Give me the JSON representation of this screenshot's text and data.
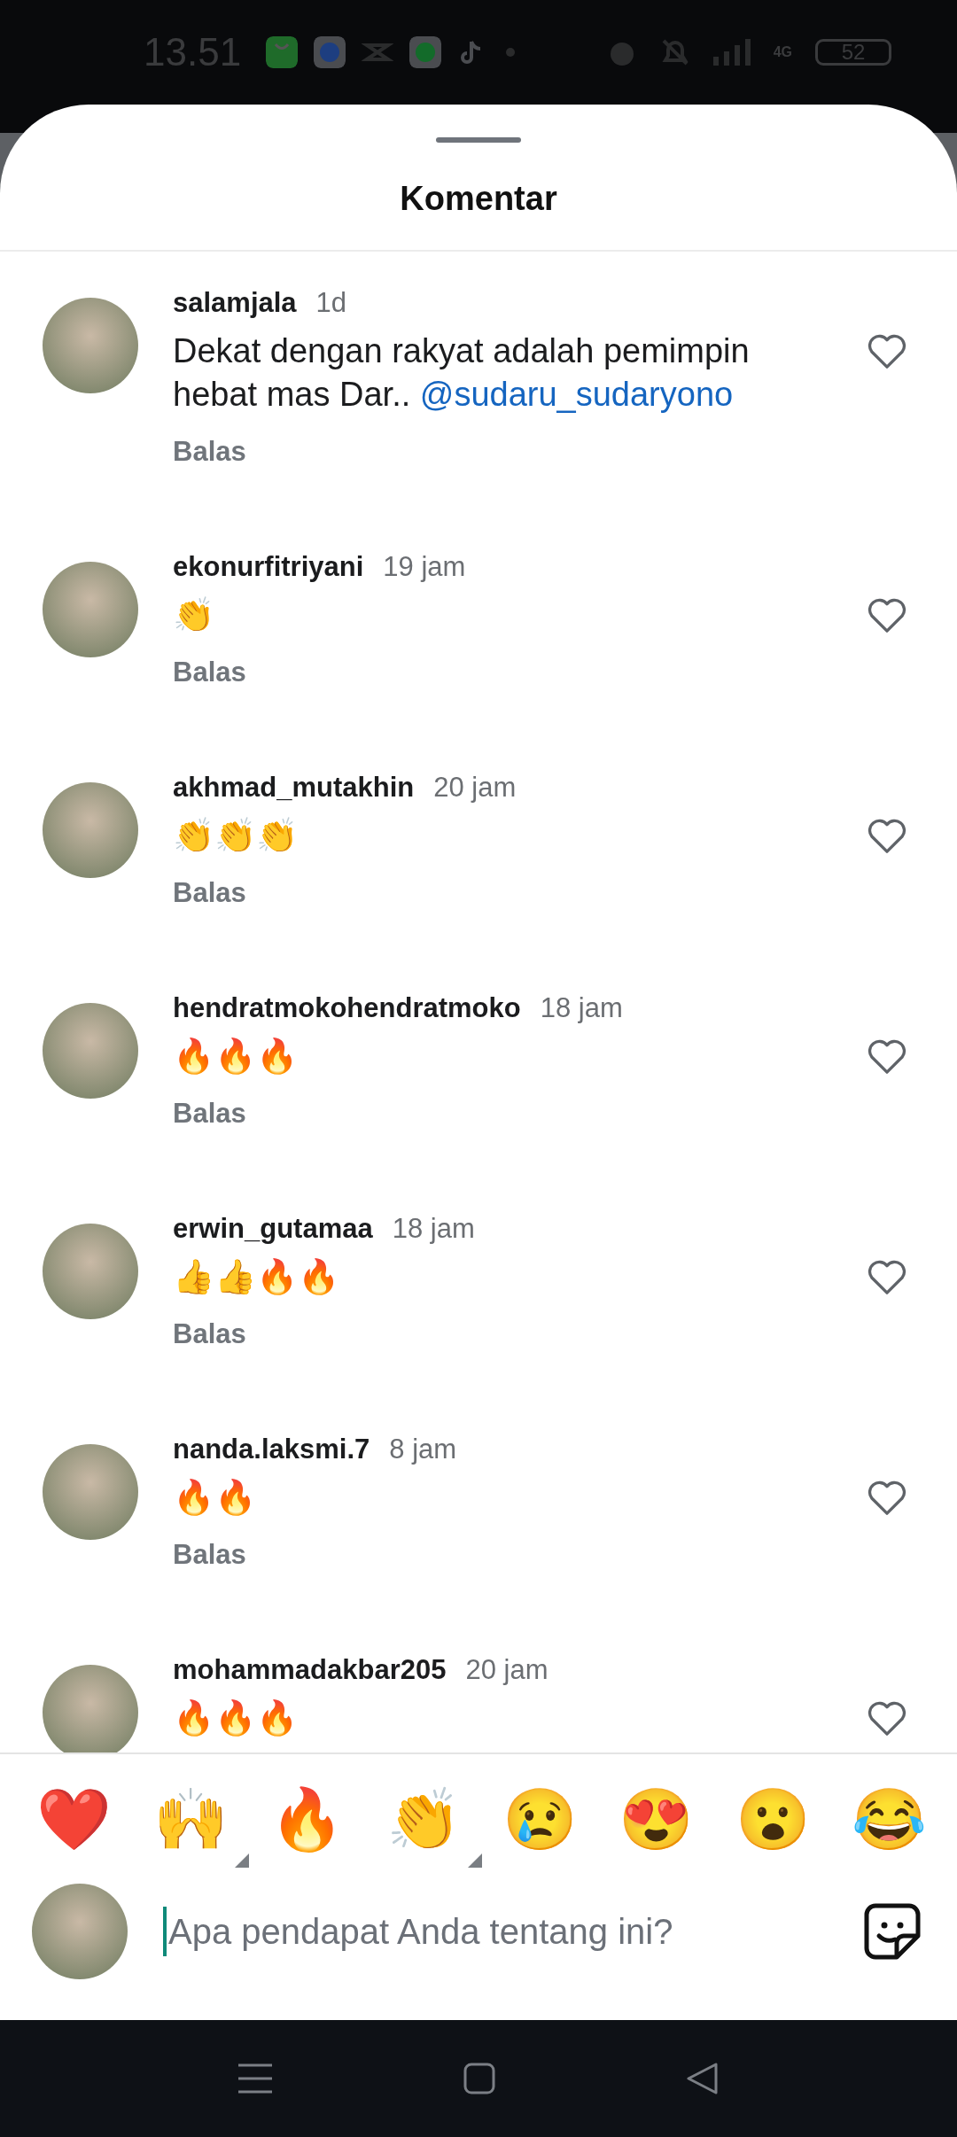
{
  "status_bar": {
    "time": "13.51",
    "network": "4G",
    "battery": "52"
  },
  "sheet": {
    "title": "Komentar"
  },
  "comments": [
    {
      "username": "salamjala",
      "time": "1d",
      "text": "Dekat dengan rakyat adalah pemimpin hebat mas Dar.. ",
      "mention": "@sudaru_sudaryono",
      "reply": "Balas",
      "liked": false
    },
    {
      "username": "ekonurfitriyani",
      "time": "19 jam",
      "text": "👏",
      "reply": "Balas",
      "liked": false
    },
    {
      "username": "akhmad_mutakhin",
      "time": "20 jam",
      "text": "👏👏👏",
      "reply": "Balas",
      "liked": false
    },
    {
      "username": "hendratmokohendratmoko",
      "time": "18 jam",
      "text": "🔥🔥🔥",
      "reply": "Balas",
      "liked": false
    },
    {
      "username": "erwin_gutamaa",
      "time": "18 jam",
      "text": "👍👍🔥🔥",
      "reply": "Balas",
      "liked": false
    },
    {
      "username": "nanda.laksmi.7",
      "time": "8 jam",
      "text": "🔥🔥",
      "reply": "Balas",
      "liked": false
    },
    {
      "username": "mohammadakbar205",
      "time": "20 jam",
      "text": "🔥🔥🔥",
      "liked": false
    }
  ],
  "quick_reactions": [
    {
      "emoji": "❤️",
      "has_variants": false
    },
    {
      "emoji": "🙌",
      "has_variants": true
    },
    {
      "emoji": "🔥",
      "has_variants": false
    },
    {
      "emoji": "👏",
      "has_variants": true
    },
    {
      "emoji": "😢",
      "has_variants": false
    },
    {
      "emoji": "😍",
      "has_variants": false
    },
    {
      "emoji": "😮",
      "has_variants": false
    },
    {
      "emoji": "😂",
      "has_variants": false
    }
  ],
  "composer": {
    "placeholder": "Apa pendapat Anda tentang ini?"
  }
}
